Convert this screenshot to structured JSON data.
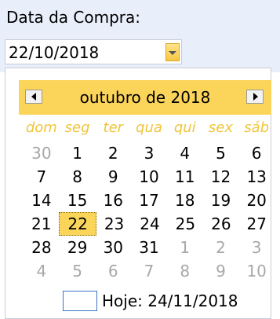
{
  "field": {
    "label": "Data da Compra:",
    "value": "22/10/2018"
  },
  "calendar": {
    "month_title": "outubro de 2018",
    "prev_icon": "chevron-left-icon",
    "next_icon": "chevron-right-icon",
    "weekdays": [
      "dom",
      "seg",
      "ter",
      "qua",
      "qui",
      "sex",
      "sáb"
    ],
    "weeks": [
      [
        {
          "d": "30",
          "m": true
        },
        {
          "d": "1"
        },
        {
          "d": "2"
        },
        {
          "d": "3"
        },
        {
          "d": "4"
        },
        {
          "d": "5"
        },
        {
          "d": "6"
        }
      ],
      [
        {
          "d": "7"
        },
        {
          "d": "8"
        },
        {
          "d": "9"
        },
        {
          "d": "10"
        },
        {
          "d": "11"
        },
        {
          "d": "12"
        },
        {
          "d": "13"
        }
      ],
      [
        {
          "d": "14"
        },
        {
          "d": "15"
        },
        {
          "d": "16"
        },
        {
          "d": "17"
        },
        {
          "d": "18"
        },
        {
          "d": "19"
        },
        {
          "d": "20"
        }
      ],
      [
        {
          "d": "21"
        },
        {
          "d": "22",
          "sel": true
        },
        {
          "d": "23"
        },
        {
          "d": "24"
        },
        {
          "d": "25"
        },
        {
          "d": "26"
        },
        {
          "d": "27"
        }
      ],
      [
        {
          "d": "28"
        },
        {
          "d": "29"
        },
        {
          "d": "30"
        },
        {
          "d": "31"
        },
        {
          "d": "1",
          "m": true
        },
        {
          "d": "2",
          "m": true
        },
        {
          "d": "3",
          "m": true
        }
      ],
      [
        {
          "d": "4",
          "m": true
        },
        {
          "d": "5",
          "m": true
        },
        {
          "d": "6",
          "m": true
        },
        {
          "d": "7",
          "m": true
        },
        {
          "d": "8",
          "m": true
        },
        {
          "d": "9",
          "m": true
        },
        {
          "d": "10",
          "m": true
        }
      ]
    ],
    "today_label": "Hoje: 24/11/2018"
  },
  "colors": {
    "header_bg": "#e9eefb",
    "accent": "#fbd45a",
    "weekday_text": "#f0c53a",
    "muted_day": "#a8a8a8"
  }
}
